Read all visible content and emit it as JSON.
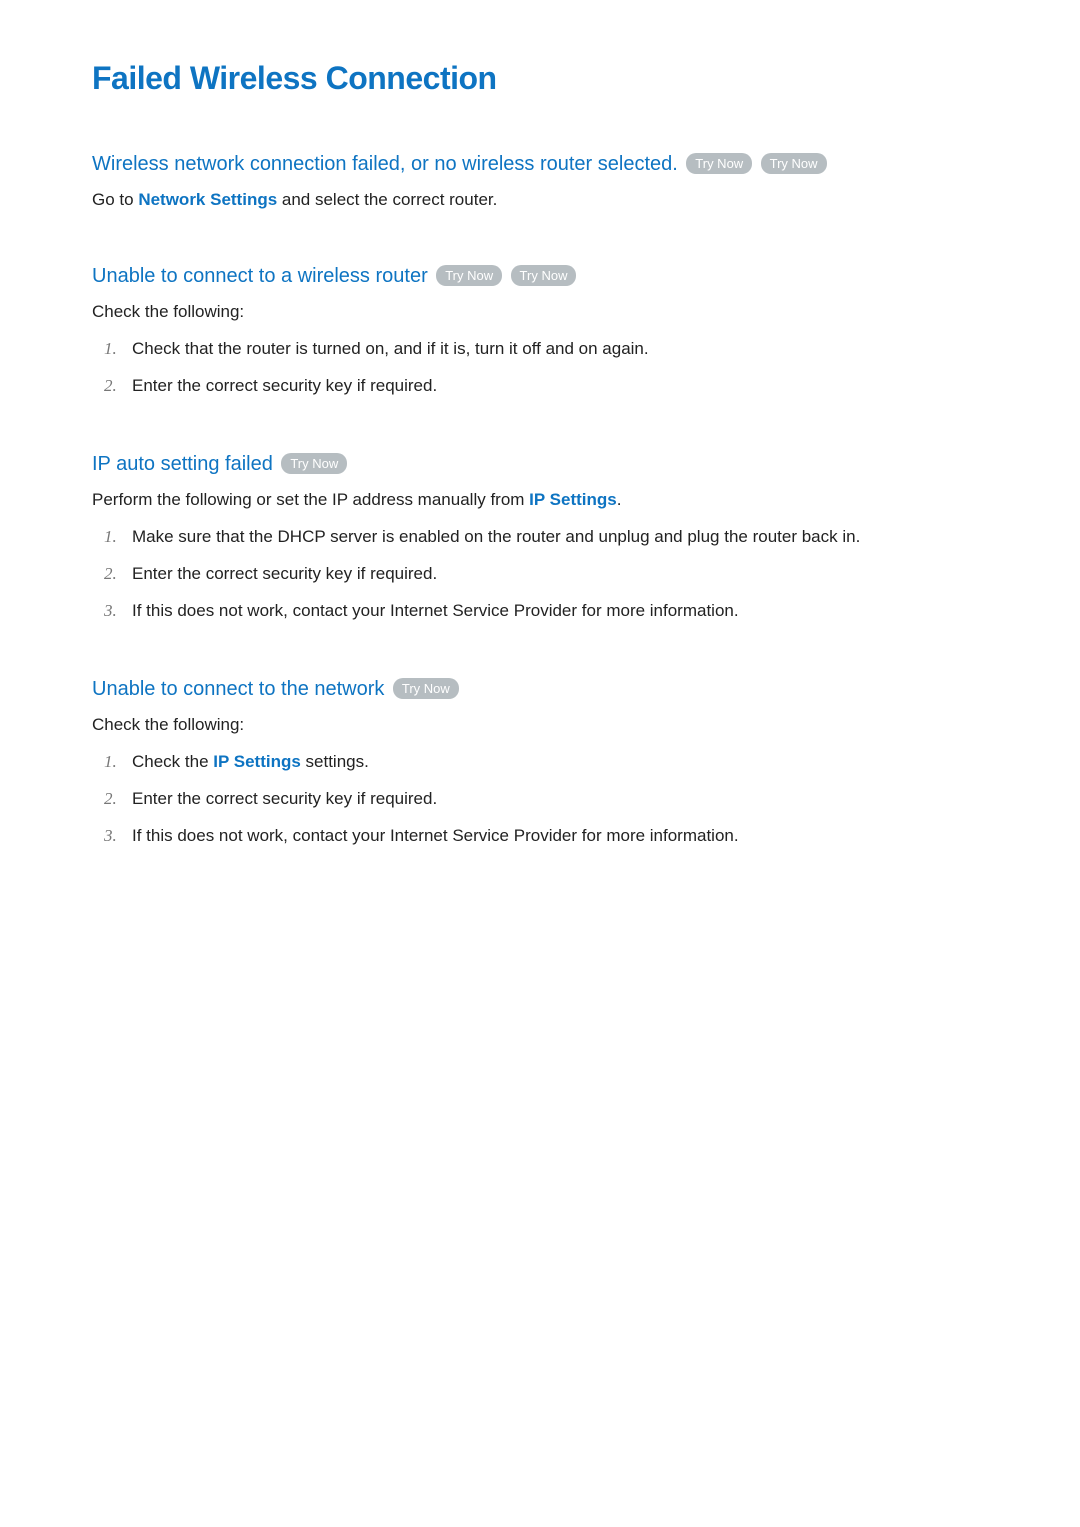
{
  "page": {
    "title": "Failed Wireless Connection",
    "try_now_label": "Try Now"
  },
  "sections": [
    {
      "heading": "Wireless network connection failed, or no wireless router selected.",
      "try_now_count": 2,
      "intro_pre": "Go to ",
      "intro_link": "Network Settings",
      "intro_post": " and select the correct router.",
      "list": []
    },
    {
      "heading": "Unable to connect to a wireless router",
      "try_now_count": 2,
      "intro_pre": "Check the following:",
      "intro_link": "",
      "intro_post": "",
      "list": [
        "Check that the router is turned on, and if it is, turn it off and on again.",
        "Enter the correct security key if required."
      ]
    },
    {
      "heading": "IP auto setting failed",
      "try_now_count": 1,
      "intro_pre": "Perform the following or set the IP address manually from ",
      "intro_link": "IP Settings",
      "intro_post": ".",
      "list": [
        "Make sure that the DHCP server is enabled on the router and unplug and plug the router back in.",
        "Enter the correct security key if required.",
        "If this does not work, contact your Internet Service Provider for more information."
      ]
    },
    {
      "heading": "Unable to connect to the network",
      "try_now_count": 1,
      "intro_pre": "Check the following:",
      "intro_link": "",
      "intro_post": "",
      "list_prefix_items": [
        {
          "pre": "Check the ",
          "link": "IP Settings",
          "post": " settings."
        },
        {
          "pre": "Enter the correct security key if required.",
          "link": "",
          "post": ""
        },
        {
          "pre": "If this does not work, contact your Internet Service Provider for more information.",
          "link": "",
          "post": ""
        }
      ]
    }
  ]
}
